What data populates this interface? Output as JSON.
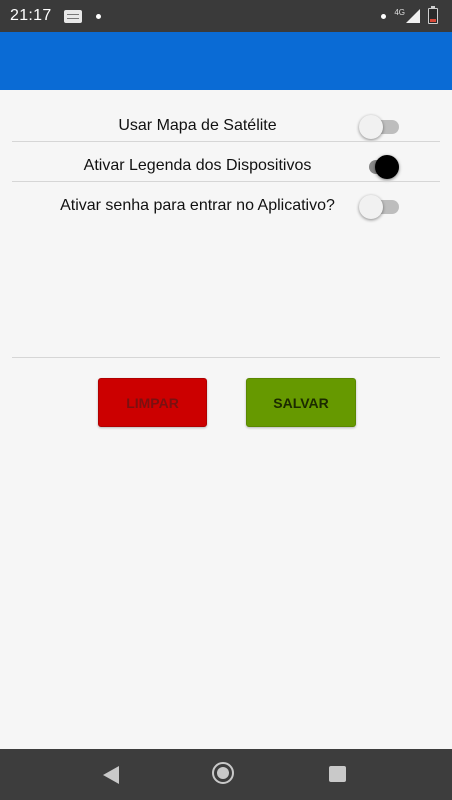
{
  "status_bar": {
    "time": "21:17",
    "network": "4G",
    "icons": [
      "notification-icon",
      "dot-icon",
      "signal-icon",
      "battery-icon"
    ]
  },
  "app_bar": {
    "color": "#0a6bd5"
  },
  "settings": [
    {
      "label": "Usar Mapa de Satélite",
      "enabled": false
    },
    {
      "label": "Ativar Legenda dos Dispositivos",
      "enabled": true
    },
    {
      "label": "Ativar senha para entrar no Aplicativo?",
      "enabled": false
    }
  ],
  "buttons": {
    "clear_label": "LIMPAR",
    "clear_color": "#cc0000",
    "save_label": "SALVAR",
    "save_color": "#669900"
  },
  "nav_bar": {
    "icons": [
      "back-icon",
      "home-icon",
      "recents-icon"
    ]
  }
}
